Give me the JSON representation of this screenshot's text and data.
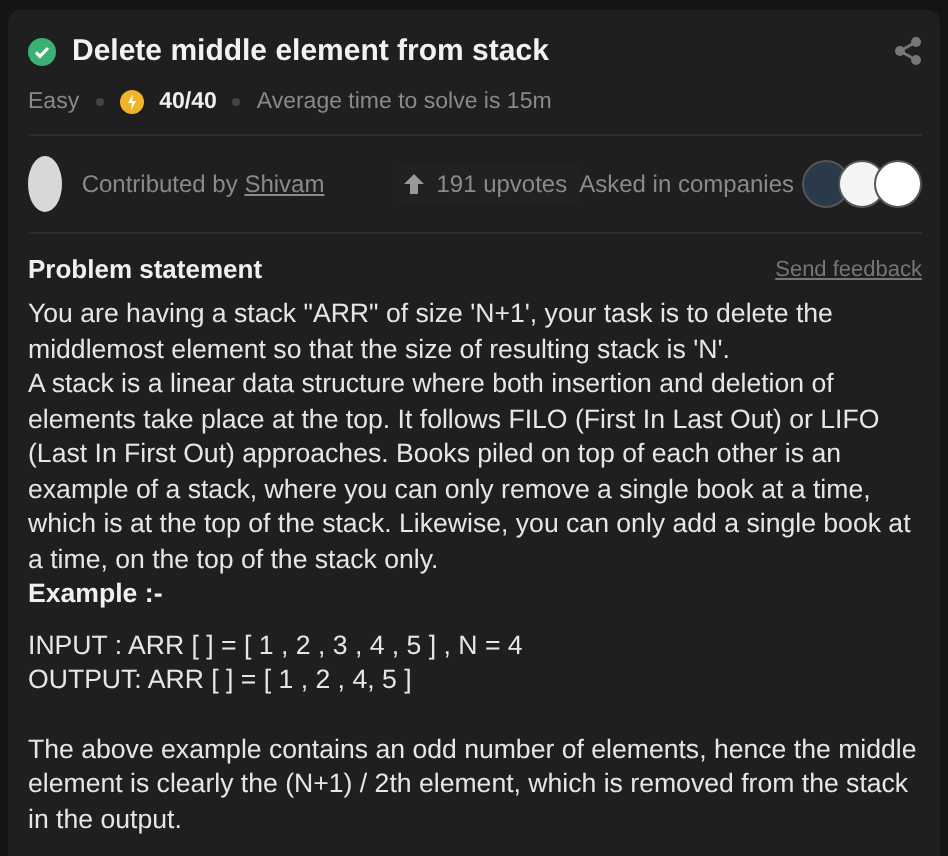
{
  "problem": {
    "title": "Delete middle element from stack",
    "difficulty": "Easy",
    "score": "40/40",
    "avg_time": "Average time to solve is 15m"
  },
  "contributor": {
    "prefix": "Contributed by",
    "name": "Shivam"
  },
  "upvotes": "191 upvotes",
  "companies": {
    "label": "Asked in companies",
    "logos": [
      {
        "color": "#2a3a4a"
      },
      {
        "color": "#f4f4f4"
      },
      {
        "color": "#ffffff"
      }
    ]
  },
  "statement": {
    "heading": "Problem statement",
    "feedback": "Send feedback",
    "paragraphs": [
      "You are having a stack \"ARR\" of size 'N+1', your task is to delete the middlemost element so that the size of resulting stack is 'N'.",
      "A stack is a linear data structure where both insertion and deletion of elements take place at the top. It follows FILO (First In Last Out) or LIFO (Last In First Out) approaches. Books piled on top of each other is an example of a stack, where you can only remove a single book at a time, which is at the top of the stack. Likewise, you can only add a single book at a time, on the top of the stack only."
    ],
    "example_heading": "Example :-",
    "example_lines": [
      "INPUT : ARR [ ] = [ 1 , 2 , 3 , 4 , 5 ] , N = 4",
      "OUTPUT: ARR [ ] = [ 1 , 2 , 4,  5 ]"
    ],
    "closing": "The above example contains an odd number of elements, hence the middle element is clearly the (N+1) / 2th element, which is removed from the stack in the output."
  }
}
